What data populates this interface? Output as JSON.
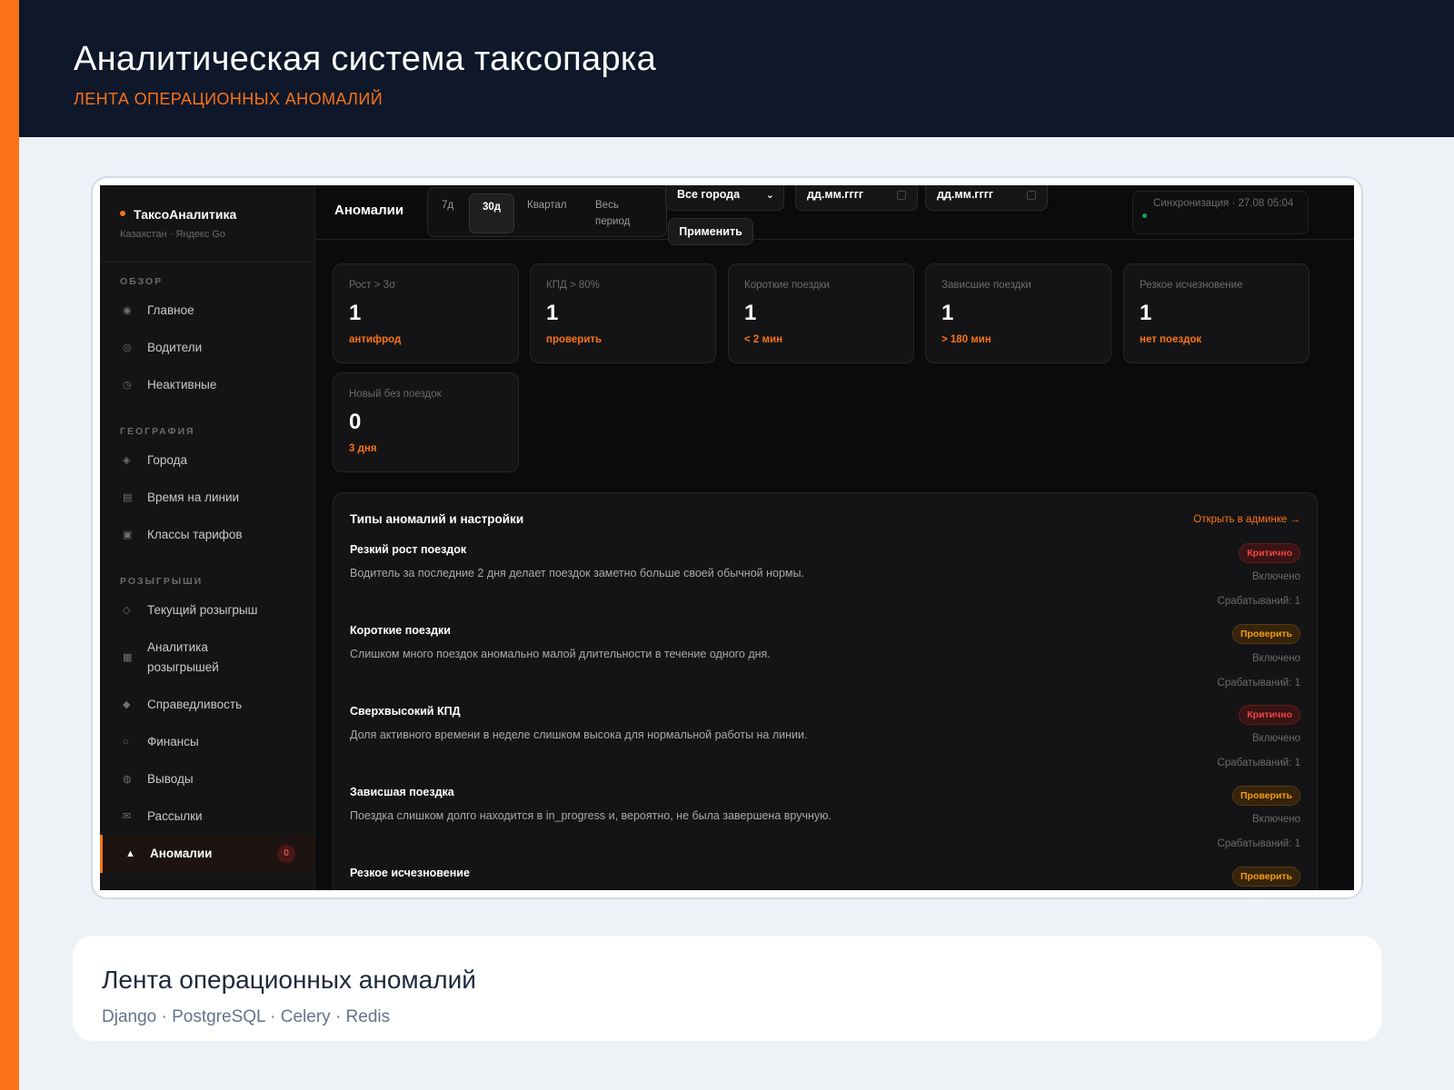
{
  "header": {
    "title": "Аналитическая система таксопарка",
    "subtitle": "ЛЕНТА ОПЕРАЦИОННЫХ АНОМАЛИЙ"
  },
  "app": {
    "brand": "ТаксоАналитика",
    "brand_sub": "Казахстан · Яндекс Go",
    "sidebar": {
      "sections": [
        "ОБЗОР",
        "ГЕОГРАФИЯ",
        "РОЗЫГРЫШИ"
      ],
      "items": [
        {
          "label": "Главное",
          "icon": "dashboard-icon"
        },
        {
          "label": "Водители",
          "icon": "drivers-icon"
        },
        {
          "label": "Неактивные",
          "icon": "clock-icon"
        },
        {
          "label": "Города",
          "icon": "cities-icon"
        },
        {
          "label": "Время на линии",
          "icon": "calendar-icon"
        },
        {
          "label": "Классы тарифов",
          "icon": "tariff-icon"
        },
        {
          "label": "Текущий розыгрыш",
          "icon": "diamond-icon"
        },
        {
          "label": "Аналитика розыгрышей",
          "icon": "bar-chart-icon"
        },
        {
          "label": "Справедливость",
          "icon": "fairness-icon"
        },
        {
          "label": "Финансы",
          "icon": "finance-icon"
        },
        {
          "label": "Выводы",
          "icon": "withdraw-icon"
        },
        {
          "label": "Рассылки",
          "icon": "mail-icon"
        },
        {
          "label": "Аномалии",
          "icon": "warning-icon",
          "badge": "0",
          "active": true
        }
      ]
    },
    "topbar": {
      "page_title": "Аномалии",
      "periods": [
        "7д",
        "30д",
        "Квартал",
        "Весь период"
      ],
      "active_period": "30д",
      "city_select": "Все города",
      "date_from_placeholder": "дд.мм.гггг",
      "date_to_placeholder": "дд.мм.гггг",
      "apply": "Применить",
      "sync": "Синхронизация · 27.08 05:04"
    },
    "cards": [
      {
        "label": "Рост > 3σ",
        "value": "1",
        "sub": "антифрод"
      },
      {
        "label": "КПД > 80%",
        "value": "1",
        "sub": "проверить"
      },
      {
        "label": "Короткие поездки",
        "value": "1",
        "sub": "< 2 мин"
      },
      {
        "label": "Зависшие поездки",
        "value": "1",
        "sub": "> 180 мин"
      },
      {
        "label": "Резкое исчезновение",
        "value": "1",
        "sub": "нет поездок"
      },
      {
        "label": "Новый без поездок",
        "value": "0",
        "sub": "3 дня"
      }
    ],
    "types": {
      "title": "Типы аномалий и настройки",
      "link": "Открыть в админке →",
      "items": [
        {
          "name": "Резкий рост поездок",
          "desc": "Водитель за последние 2 дня делает поездок заметно больше своей обычной нормы.",
          "severity": "Критично",
          "status": "Включено",
          "triggers": "Срабатываний: 1"
        },
        {
          "name": "Короткие поездки",
          "desc": "Слишком много поездок аномально малой длительности в течение одного дня.",
          "severity": "Проверить",
          "status": "Включено",
          "triggers": "Срабатываний: 1"
        },
        {
          "name": "Сверхвысокий КПД",
          "desc": "Доля активного времени в неделе слишком высока для нормальной работы на линии.",
          "severity": "Критично",
          "status": "Включено",
          "triggers": "Срабатываний: 1"
        },
        {
          "name": "Зависшая поездка",
          "desc": "Поездка слишком долго находится в in_progress и, вероятно, не была завершена вручную.",
          "severity": "Проверить",
          "status": "Включено",
          "triggers": "Срабатываний: 1"
        },
        {
          "name": "Резкое исчезновение",
          "desc": "",
          "severity": "Проверить",
          "status": "",
          "triggers": ""
        }
      ]
    }
  },
  "caption": {
    "title": "Лента операционных аномалий",
    "stack": "Django · PostgreSQL · Celery · Redis"
  },
  "colors": {
    "accent": "#f97316",
    "header_bg": "#0f172a",
    "critical": "#ef4444",
    "check": "#f59e0b",
    "sync_ok": "#16a34a"
  }
}
